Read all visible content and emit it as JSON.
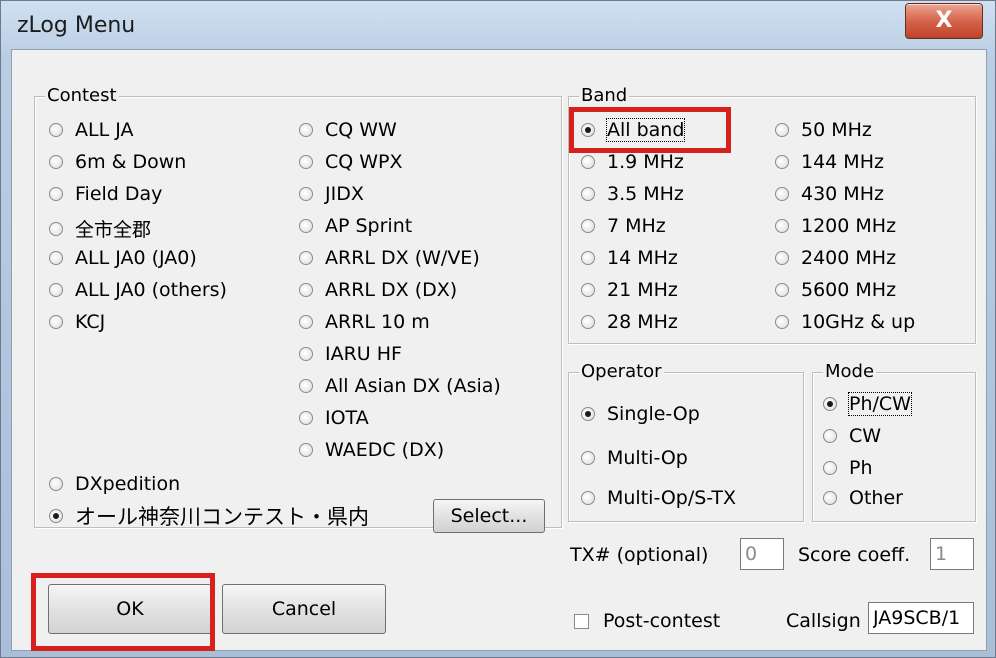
{
  "window": {
    "title": "zLog Menu",
    "close_glyph": "X"
  },
  "contest": {
    "legend": "Contest",
    "col1": [
      "ALL JA",
      "6m & Down",
      "Field Day",
      "全市全郡",
      "ALL JA0 (JA0)",
      "ALL JA0 (others)",
      "KCJ"
    ],
    "col2": [
      "CQ WW",
      "CQ WPX",
      "JIDX",
      "AP Sprint",
      "ARRL DX (W/VE)",
      "ARRL DX (DX)",
      "ARRL 10 m",
      "IARU HF",
      "All Asian DX (Asia)",
      "IOTA",
      "WAEDC (DX)"
    ],
    "dxpedition": "DXpedition",
    "selected_label": "オール神奈川コンテスト・県内",
    "select_button": "Select..."
  },
  "band": {
    "legend": "Band",
    "col1": [
      "All band",
      "1.9 MHz",
      "3.5 MHz",
      "7 MHz",
      "14 MHz",
      "21 MHz",
      "28 MHz"
    ],
    "col2": [
      "50 MHz",
      "144 MHz",
      "430 MHz",
      "1200 MHz",
      "2400 MHz",
      "5600 MHz",
      "10GHz & up"
    ]
  },
  "operator": {
    "legend": "Operator",
    "options": [
      "Single-Op",
      "Multi-Op",
      "Multi-Op/S-TX"
    ]
  },
  "mode": {
    "legend": "Mode",
    "options": [
      "Ph/CW",
      "CW",
      "Ph",
      "Other"
    ]
  },
  "tx": {
    "label": "TX# (optional)",
    "value": "0"
  },
  "score": {
    "label": "Score coeff.",
    "value": "1"
  },
  "post": {
    "label": "Post-contest"
  },
  "callsign": {
    "label": "Callsign",
    "value": "JA9SCB/1"
  },
  "buttons": {
    "ok": "OK",
    "cancel": "Cancel"
  },
  "colors": {
    "highlight": "#d6211f"
  }
}
